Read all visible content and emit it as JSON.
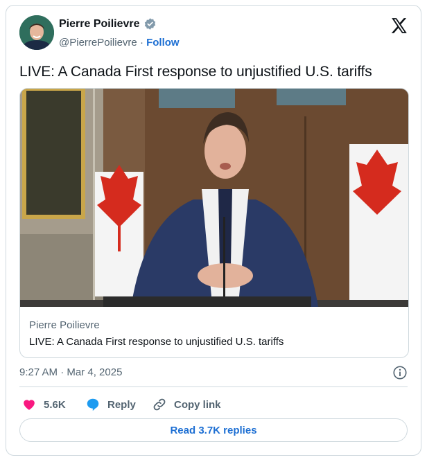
{
  "author": {
    "name": "Pierre Poilievre",
    "handle": "@PierrePoilievre",
    "separator": "·",
    "follow_label": "Follow",
    "avatar_icon": "profile-photo",
    "verified_icon": "verified-badge-icon"
  },
  "platform": {
    "logo_icon": "x-logo-icon"
  },
  "tweet": {
    "text": "LIVE: A Canada First response to unjustified U.S. tariffs"
  },
  "media": {
    "image_icon": "video-thumbnail",
    "source": "Pierre Poilievre",
    "title": "LIVE: A Canada First response to unjustified U.S. tariffs"
  },
  "meta": {
    "timestamp": "9:27 AM · Mar 4, 2025"
  },
  "actions": {
    "likes_count": "5.6K",
    "reply_label": "Reply",
    "copy_link_label": "Copy link"
  },
  "read_replies_label": "Read 3.7K replies",
  "colors": {
    "like": "#f91880",
    "reply": "#1d9bf0",
    "link": "#1d6fd3",
    "border": "#cfd9de",
    "muted": "#536471"
  }
}
